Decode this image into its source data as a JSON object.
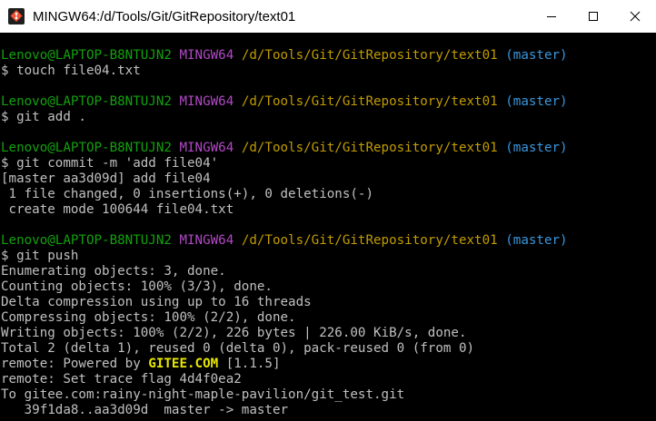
{
  "window": {
    "title": "MINGW64:/d/Tools/Git/GitRepository/text01"
  },
  "prompt": {
    "user": "Lenovo@LAPTOP-B8NTUJN2",
    "system": "MINGW64",
    "path": "/d/Tools/Git/GitRepository/text01",
    "branch": "(master)"
  },
  "blocks": [
    {
      "command": "$ touch file04.txt",
      "output": []
    },
    {
      "command": "$ git add .",
      "output": []
    },
    {
      "command": "$ git commit -m 'add file04'",
      "output": [
        "[master aa3d09d] add file04",
        " 1 file changed, 0 insertions(+), 0 deletions(-)",
        " create mode 100644 file04.txt"
      ]
    },
    {
      "command": "$ git push",
      "output": [
        "Enumerating objects: 3, done.",
        "Counting objects: 100% (3/3), done.",
        "Delta compression using up to 16 threads",
        "Compressing objects: 100% (2/2), done.",
        "Writing objects: 100% (2/2), 226 bytes | 226.00 KiB/s, done.",
        "Total 2 (delta 1), reused 0 (delta 0), pack-reused 0 (from 0)"
      ]
    }
  ],
  "remote": {
    "powered_prefix": "remote: Powered by ",
    "powered_brand": "GITEE.COM",
    "powered_suffix": " [1.1.5]",
    "trace": "remote: Set trace flag 4d4f0ea2",
    "to": "To gitee.com:rainy-night-maple-pavilion/git_test.git",
    "ref_update": "   39f1da8..aa3d09d  master -> master"
  },
  "colors": {
    "user": "#13a10e",
    "system": "#b148c6",
    "path": "#c19c00",
    "branch": "#3a96dd",
    "text": "#c0c0c0",
    "brand": "#e8e800",
    "background": "#000000"
  },
  "icons": {
    "app": "git-bash-icon",
    "minimize": "minimize-icon",
    "maximize": "maximize-icon",
    "close": "close-icon"
  }
}
